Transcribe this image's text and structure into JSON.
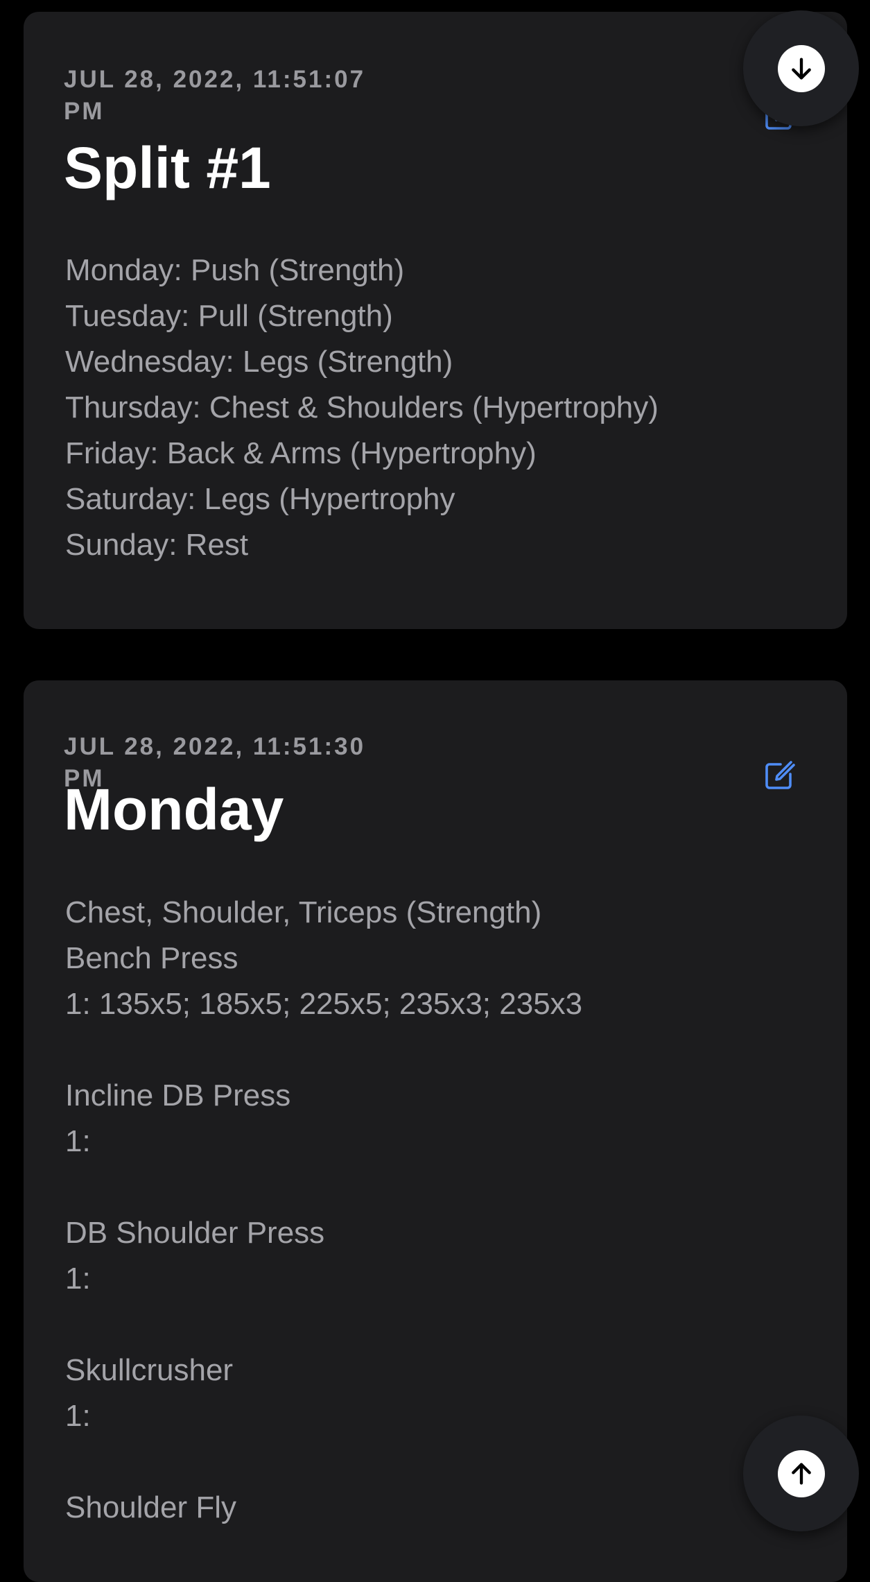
{
  "colors": {
    "background": "#000000",
    "card": "#1c1c1e",
    "accent": "#4f8df7",
    "title": "#ffffff",
    "muted": "#a4a4a9"
  },
  "entries": [
    {
      "timestamp_line1": "JUL 28, 2022, 11:51:07",
      "timestamp_line2": "PM",
      "title": "Split #1",
      "lines": [
        "Monday: Push (Strength)",
        "Tuesday: Pull (Strength)",
        "Wednesday: Legs (Strength)",
        "Thursday: Chest & Shoulders (Hypertrophy)",
        "Friday: Back & Arms (Hypertrophy)",
        "Saturday: Legs (Hypertrophy",
        "Sunday: Rest"
      ],
      "edit_icon": "edit-icon"
    },
    {
      "timestamp_line1": "JUL 28, 2022, 11:51:30",
      "timestamp_line2": "PM",
      "title": "Monday",
      "lines": [
        "Chest, Shoulder, Triceps (Strength)",
        "Bench Press",
        "1: 135x5; 185x5; 225x5; 235x3; 235x3",
        "",
        "Incline DB Press",
        "1:",
        "",
        "DB Shoulder Press",
        "1:",
        "",
        "Skullcrusher",
        "1:",
        "",
        "Shoulder Fly"
      ],
      "edit_icon": "edit-icon"
    }
  ],
  "fab_down": {
    "icon": "arrow-down-icon"
  },
  "fab_up": {
    "icon": "arrow-up-icon"
  }
}
